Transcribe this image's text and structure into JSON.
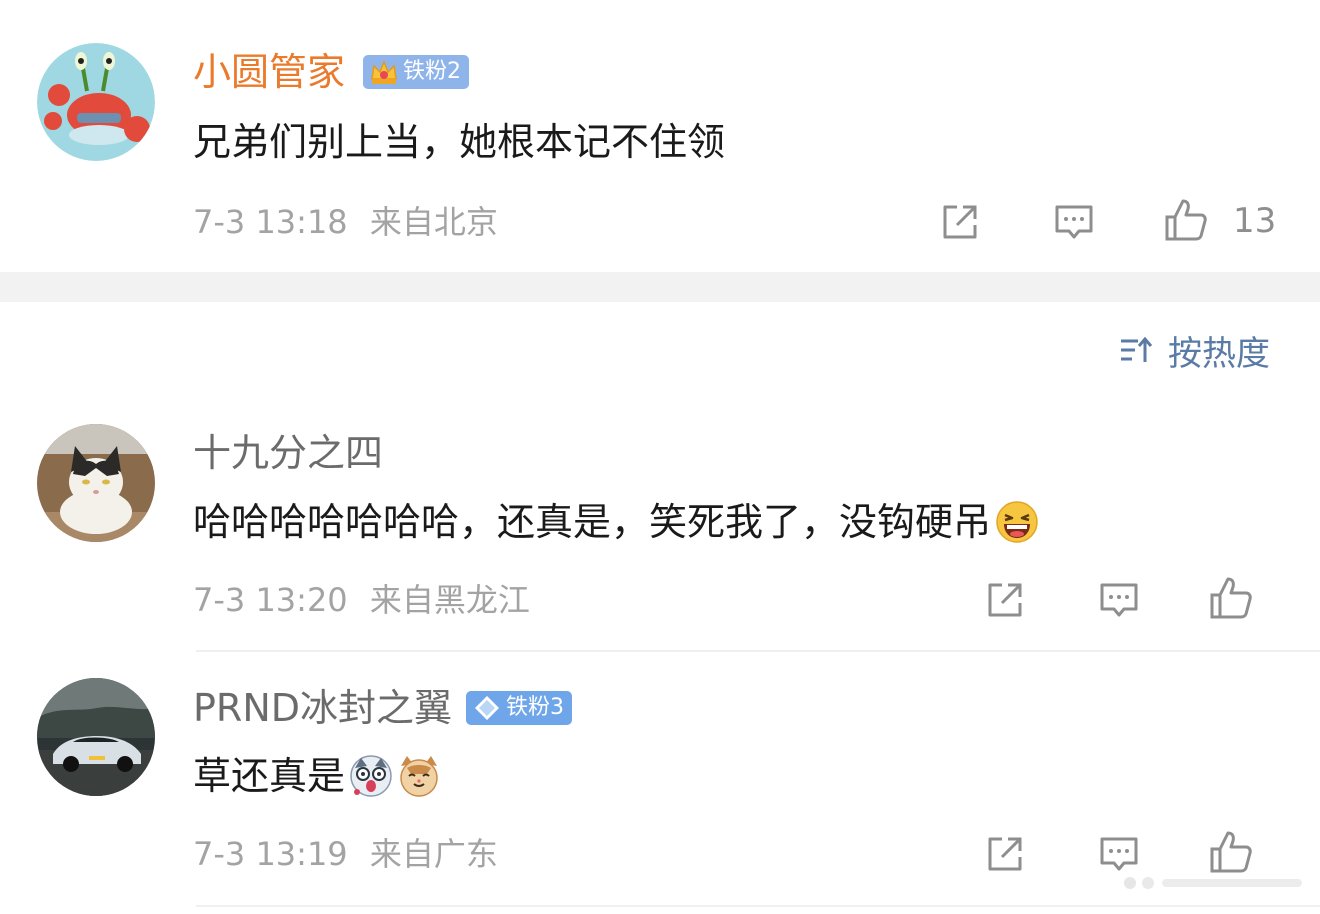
{
  "comments": [
    {
      "user": "小圆管家",
      "badge": "铁粉2",
      "text": "兄弟们别上当，她根本记不住领",
      "date": "7-3 13:18",
      "location": "来自北京",
      "likes": "13",
      "avatar_icon": "crab-cartoon-avatar"
    },
    {
      "user": "十九分之四",
      "badge": "",
      "text": "哈哈哈哈哈哈哈，还真是，笑死我了，没钩硬吊",
      "emoji": [
        "laughing-emoji"
      ],
      "date": "7-3 13:20",
      "location": "来自黑龙江",
      "likes": "",
      "avatar_icon": "cat-photo-avatar"
    },
    {
      "user": "PRND冰封之翼",
      "badge": "铁粉3",
      "text": "草还真是",
      "emoji": [
        "shocked-dog-emoji",
        "cat-face-emoji"
      ],
      "date": "7-3 13:19",
      "location": "来自广东",
      "likes": "",
      "avatar_icon": "car-photo-avatar"
    }
  ],
  "sort": {
    "label": "按热度",
    "icon": "sort-icon"
  },
  "colors": {
    "username_orange": "#eb7b2c",
    "username_gray": "#6b6b6b",
    "meta_gray": "#a3a3a3",
    "sort_blue": "#5a7ba6",
    "badge_blue": "#8fb4ea"
  }
}
